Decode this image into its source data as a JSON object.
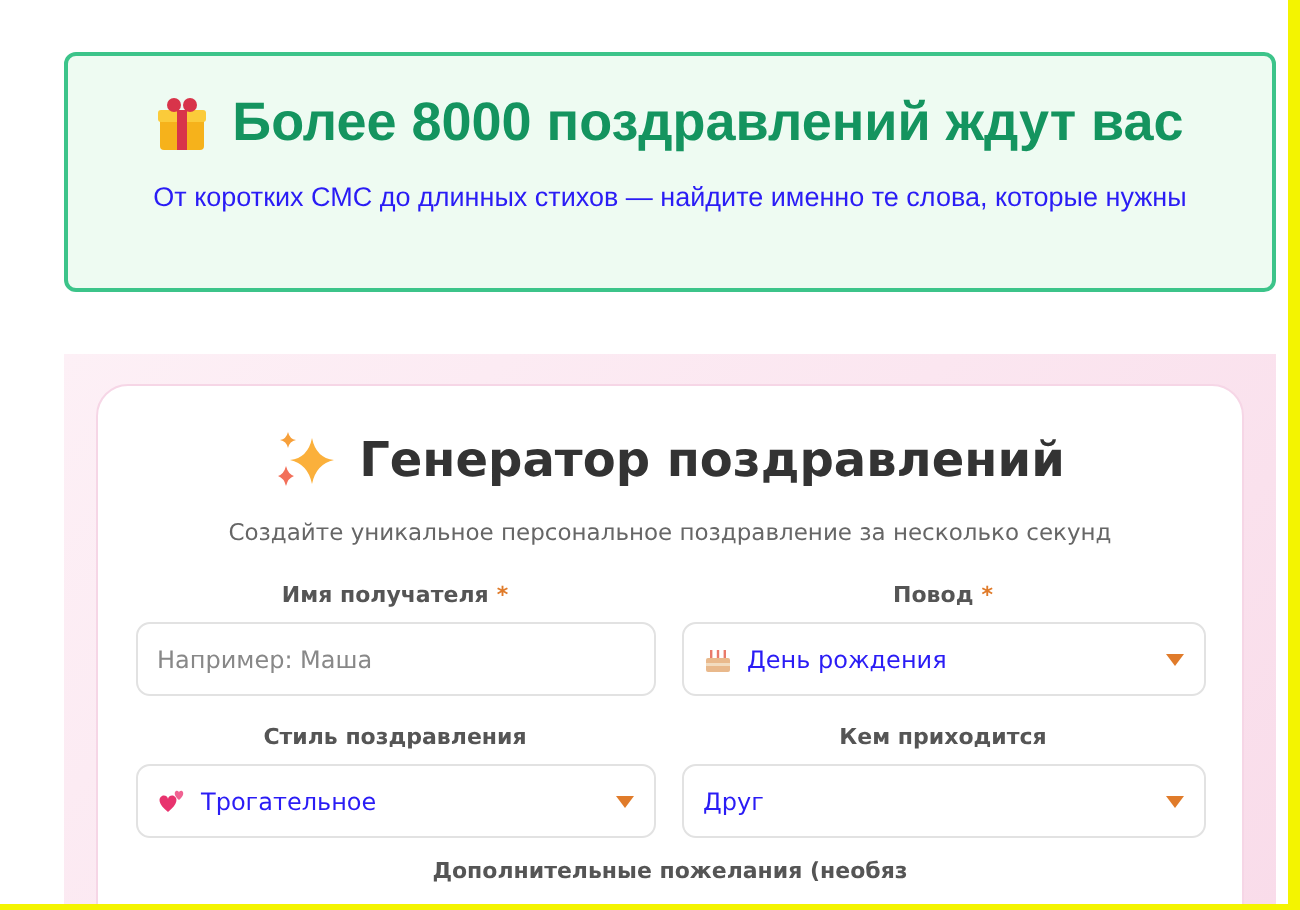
{
  "banner": {
    "title": "Более 8000 поздравлений ждут вас",
    "subtitle": "От коротких СМС до длинных стихов — найдите именно те слова, которые нужны"
  },
  "generator": {
    "title": "Генератор поздравлений",
    "subtitle": "Создайте уникальное персональное поздравление за несколько секунд",
    "fields": [
      {
        "kind": "text",
        "label": "Имя получателя",
        "required_mark": "*",
        "placeholder": "Например: Маша"
      },
      {
        "kind": "select",
        "label": "Повод",
        "required_mark": "*",
        "value": "День рождения"
      },
      {
        "kind": "select",
        "label": "Стиль поздравления",
        "value": "Трогательное"
      },
      {
        "kind": "select",
        "label": "Кем приходится",
        "value": "Друг"
      }
    ],
    "extra_label": "Дополнительные пожелания (необяз"
  }
}
